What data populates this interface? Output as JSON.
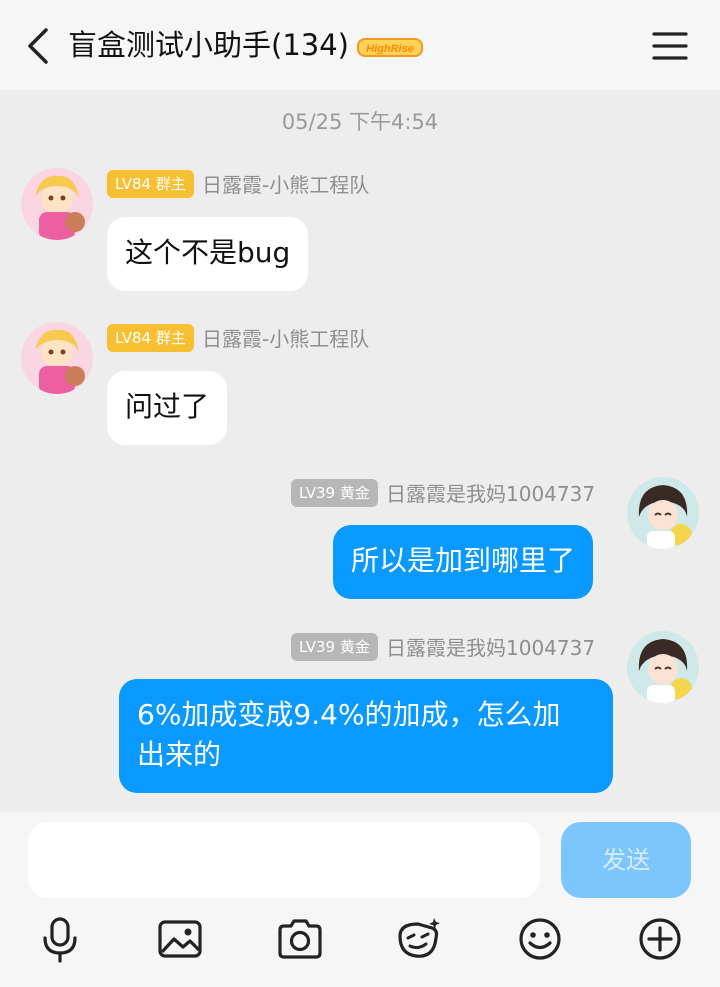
{
  "header": {
    "title": "盲盒测试小助手(134)",
    "logo_text": "HighRise",
    "back_icon": "chevron-left-icon",
    "menu_icon": "hamburger-menu-icon"
  },
  "timestamp": "05/25 下午4:54",
  "messages": [
    {
      "direction": "in",
      "level": "LV84 群主",
      "name": "日露霞-小熊工程队",
      "text": "这个不是bug"
    },
    {
      "direction": "in",
      "level": "LV84 群主",
      "name": "日露霞-小熊工程队",
      "text": "问过了"
    },
    {
      "direction": "out",
      "level": "LV39 黄金",
      "name": "日露霞是我妈1004737",
      "text": "所以是加到哪里了"
    },
    {
      "direction": "out",
      "level": "LV39 黄金",
      "name": "日露霞是我妈1004737",
      "text_line1": "6%加成变成9.4%的加成，怎么加",
      "text_line2": "出来的"
    }
  ],
  "composer": {
    "input_value": "",
    "send_label": "发送"
  },
  "toolbar": [
    "microphone-icon",
    "image-icon",
    "camera-icon",
    "sticker-icon",
    "emoji-icon",
    "plus-icon"
  ],
  "colors": {
    "accent": "#0a99ff",
    "send_disabled": "#7cc6fd",
    "owner_badge": "#f7c032",
    "gold_badge": "#b7b7b7",
    "background": "#ededed"
  }
}
